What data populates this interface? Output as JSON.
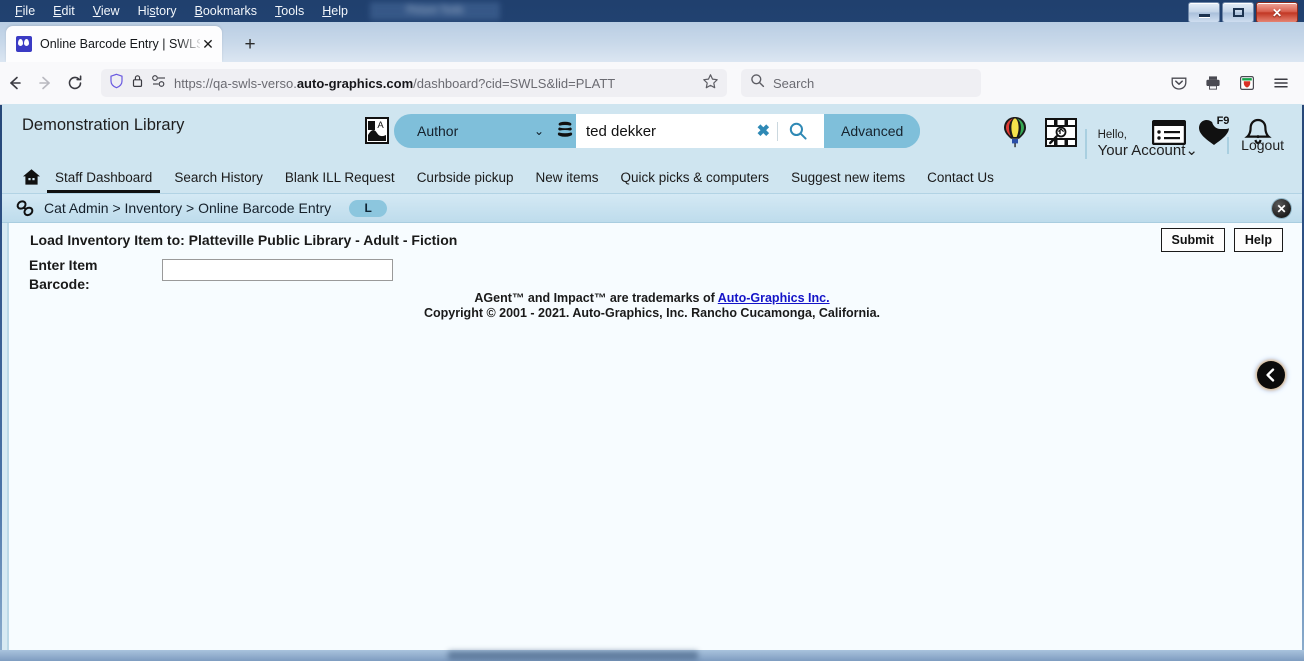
{
  "window": {
    "title_faded": "Picture Tools",
    "controls": {
      "minimize": "minimize-button",
      "maximize": "maximize-button",
      "close": "✕"
    }
  },
  "menubar": {
    "items": [
      "File",
      "Edit",
      "View",
      "History",
      "Bookmarks",
      "Tools",
      "Help"
    ]
  },
  "browser": {
    "tab": {
      "title": "Online Barcode Entry | SWLS | pl",
      "close": "✕",
      "favicon": "owl-favicon"
    },
    "new_tab": "+",
    "nav": {
      "back": "back-arrow",
      "forward": "forward-arrow",
      "reload": "reload-icon"
    },
    "url": {
      "prefix": "https://qa-swls-verso.",
      "domain": "auto-graphics.com",
      "path": "/dashboard?cid=SWLS&lid=PLATT"
    },
    "search_placeholder": "Search",
    "right_icons": [
      "pocket-icon",
      "print-icon",
      "extension-icon",
      "hamburger-menu-icon"
    ]
  },
  "app_header": {
    "library_name": "Demonstration Library",
    "translate_icon": "translate-icon",
    "scope": {
      "value": "Author",
      "caret": "⌄"
    },
    "database_icon": "database-stack-icon",
    "query": {
      "value": "ted dekker",
      "clear": "✖"
    },
    "search_icon": "magnifier-icon",
    "advanced_label": "Advanced",
    "icons": [
      {
        "name": "balloon-icon"
      },
      {
        "name": "image-search-icon"
      },
      {
        "name": "list-icon"
      },
      {
        "name": "favorites-heart-icon",
        "badge": "F9"
      },
      {
        "name": "notifications-bell-icon"
      }
    ],
    "account": {
      "hello": "Hello,",
      "name": "Your Account",
      "caret": "⌄"
    },
    "logout": "Logout"
  },
  "nav": {
    "home_icon": "home-icon",
    "links": [
      "Staff Dashboard",
      "Search History",
      "Blank ILL Request",
      "Curbside pickup",
      "New items",
      "Quick picks & computers",
      "Suggest new items",
      "Contact Us"
    ]
  },
  "breadcrumb": {
    "icon": "chain-link-icon",
    "text": "Cat Admin > Inventory > Online Barcode Entry",
    "pill": "L",
    "close": "✕"
  },
  "content": {
    "load_title": "Load Inventory Item to: Platteville Public Library - Adult - Fiction",
    "submit_label": "Submit",
    "help_label": "Help",
    "barcode_label_line1": "Enter Item",
    "barcode_label_line2": "Barcode:",
    "barcode_value": "",
    "barcode_placeholder": "",
    "footer_line1_pre": "AGent™ and Impact™ are trademarks of ",
    "footer_link": "Auto-Graphics Inc.",
    "footer_line2": "Copyright © 2001 - 2021. Auto-Graphics, Inc. Rancho Cucamonga, California.",
    "back_button": "back-circle-button"
  },
  "colors": {
    "header_bg": "#cfe5f0",
    "accent": "#7fbfda",
    "pill": "#8cc6de",
    "link": "#1414c8",
    "page_bg": "#f7fcff"
  }
}
